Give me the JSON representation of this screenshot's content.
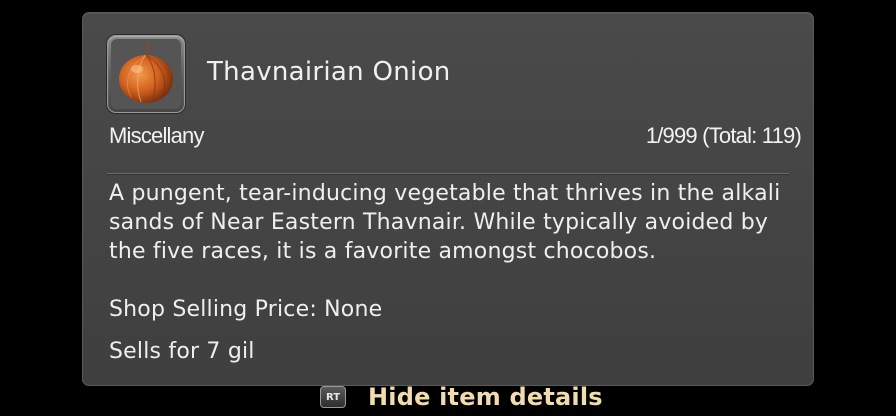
{
  "item": {
    "icon": "onion-icon",
    "name": "Thavnairian Onion",
    "category": "Miscellany",
    "stack": "1/999 (Total: 119)",
    "description": "A pungent, tear-inducing vegetable that thrives in the alkali sands of Near Eastern Thavnair. While typically avoided by the five races, it is a favorite amongst chocobos.",
    "shop_price": "Shop Selling Price: None",
    "sells_for": "Sells for 7 gil"
  },
  "footer": {
    "button_glyph": "RT",
    "hint": "Hide item details"
  },
  "colors": {
    "panel": "#444444",
    "hint_text": "#f1dcae",
    "onion": "#c8551a"
  }
}
